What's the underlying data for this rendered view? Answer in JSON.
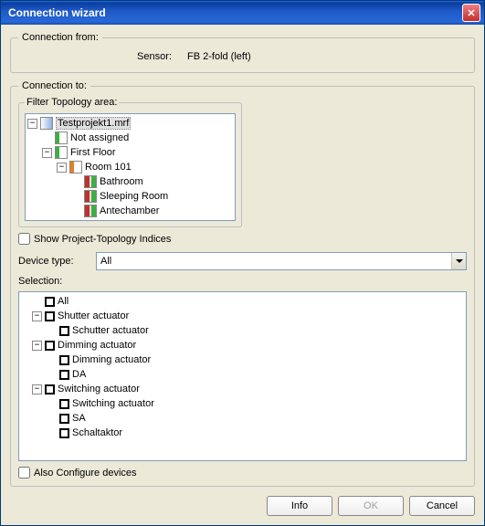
{
  "window": {
    "title": "Connection wizard"
  },
  "from": {
    "legend": "Connection from:",
    "sensorLabel": "Sensor:",
    "sensorValue": "FB 2-fold  (left)"
  },
  "to": {
    "legend": "Connection to:",
    "filterLegend": "Filter Topology area:",
    "showIndicesLabel": "Show Project-Topology Indices",
    "deviceTypeLabel": "Device type:",
    "deviceTypeValue": "All",
    "selectionLabel": "Selection:",
    "alsoConfigureLabel": "Also Configure devices"
  },
  "topologyTree": {
    "root": "Testprojekt1.mrf",
    "notAssigned": "Not assigned",
    "firstFloor": "First Floor",
    "room101": "Room 101",
    "bathroom": "Bathroom",
    "sleepingRoom": "Sleeping Room",
    "antechamber": "Antechamber"
  },
  "selectionTree": {
    "all": "All",
    "shutterAct": "Shutter actuator",
    "schutterAct": "Schutter actuator",
    "dimmingAct": "Dimming actuator",
    "dimmingAct2": "Dimming actuator",
    "da": "DA",
    "switchingAct": "Switching actuator",
    "switchingAct2": "Switching actuator",
    "sa": "SA",
    "schaltaktor": "Schaltaktor"
  },
  "buttons": {
    "info": "Info",
    "ok": "OK",
    "cancel": "Cancel"
  }
}
